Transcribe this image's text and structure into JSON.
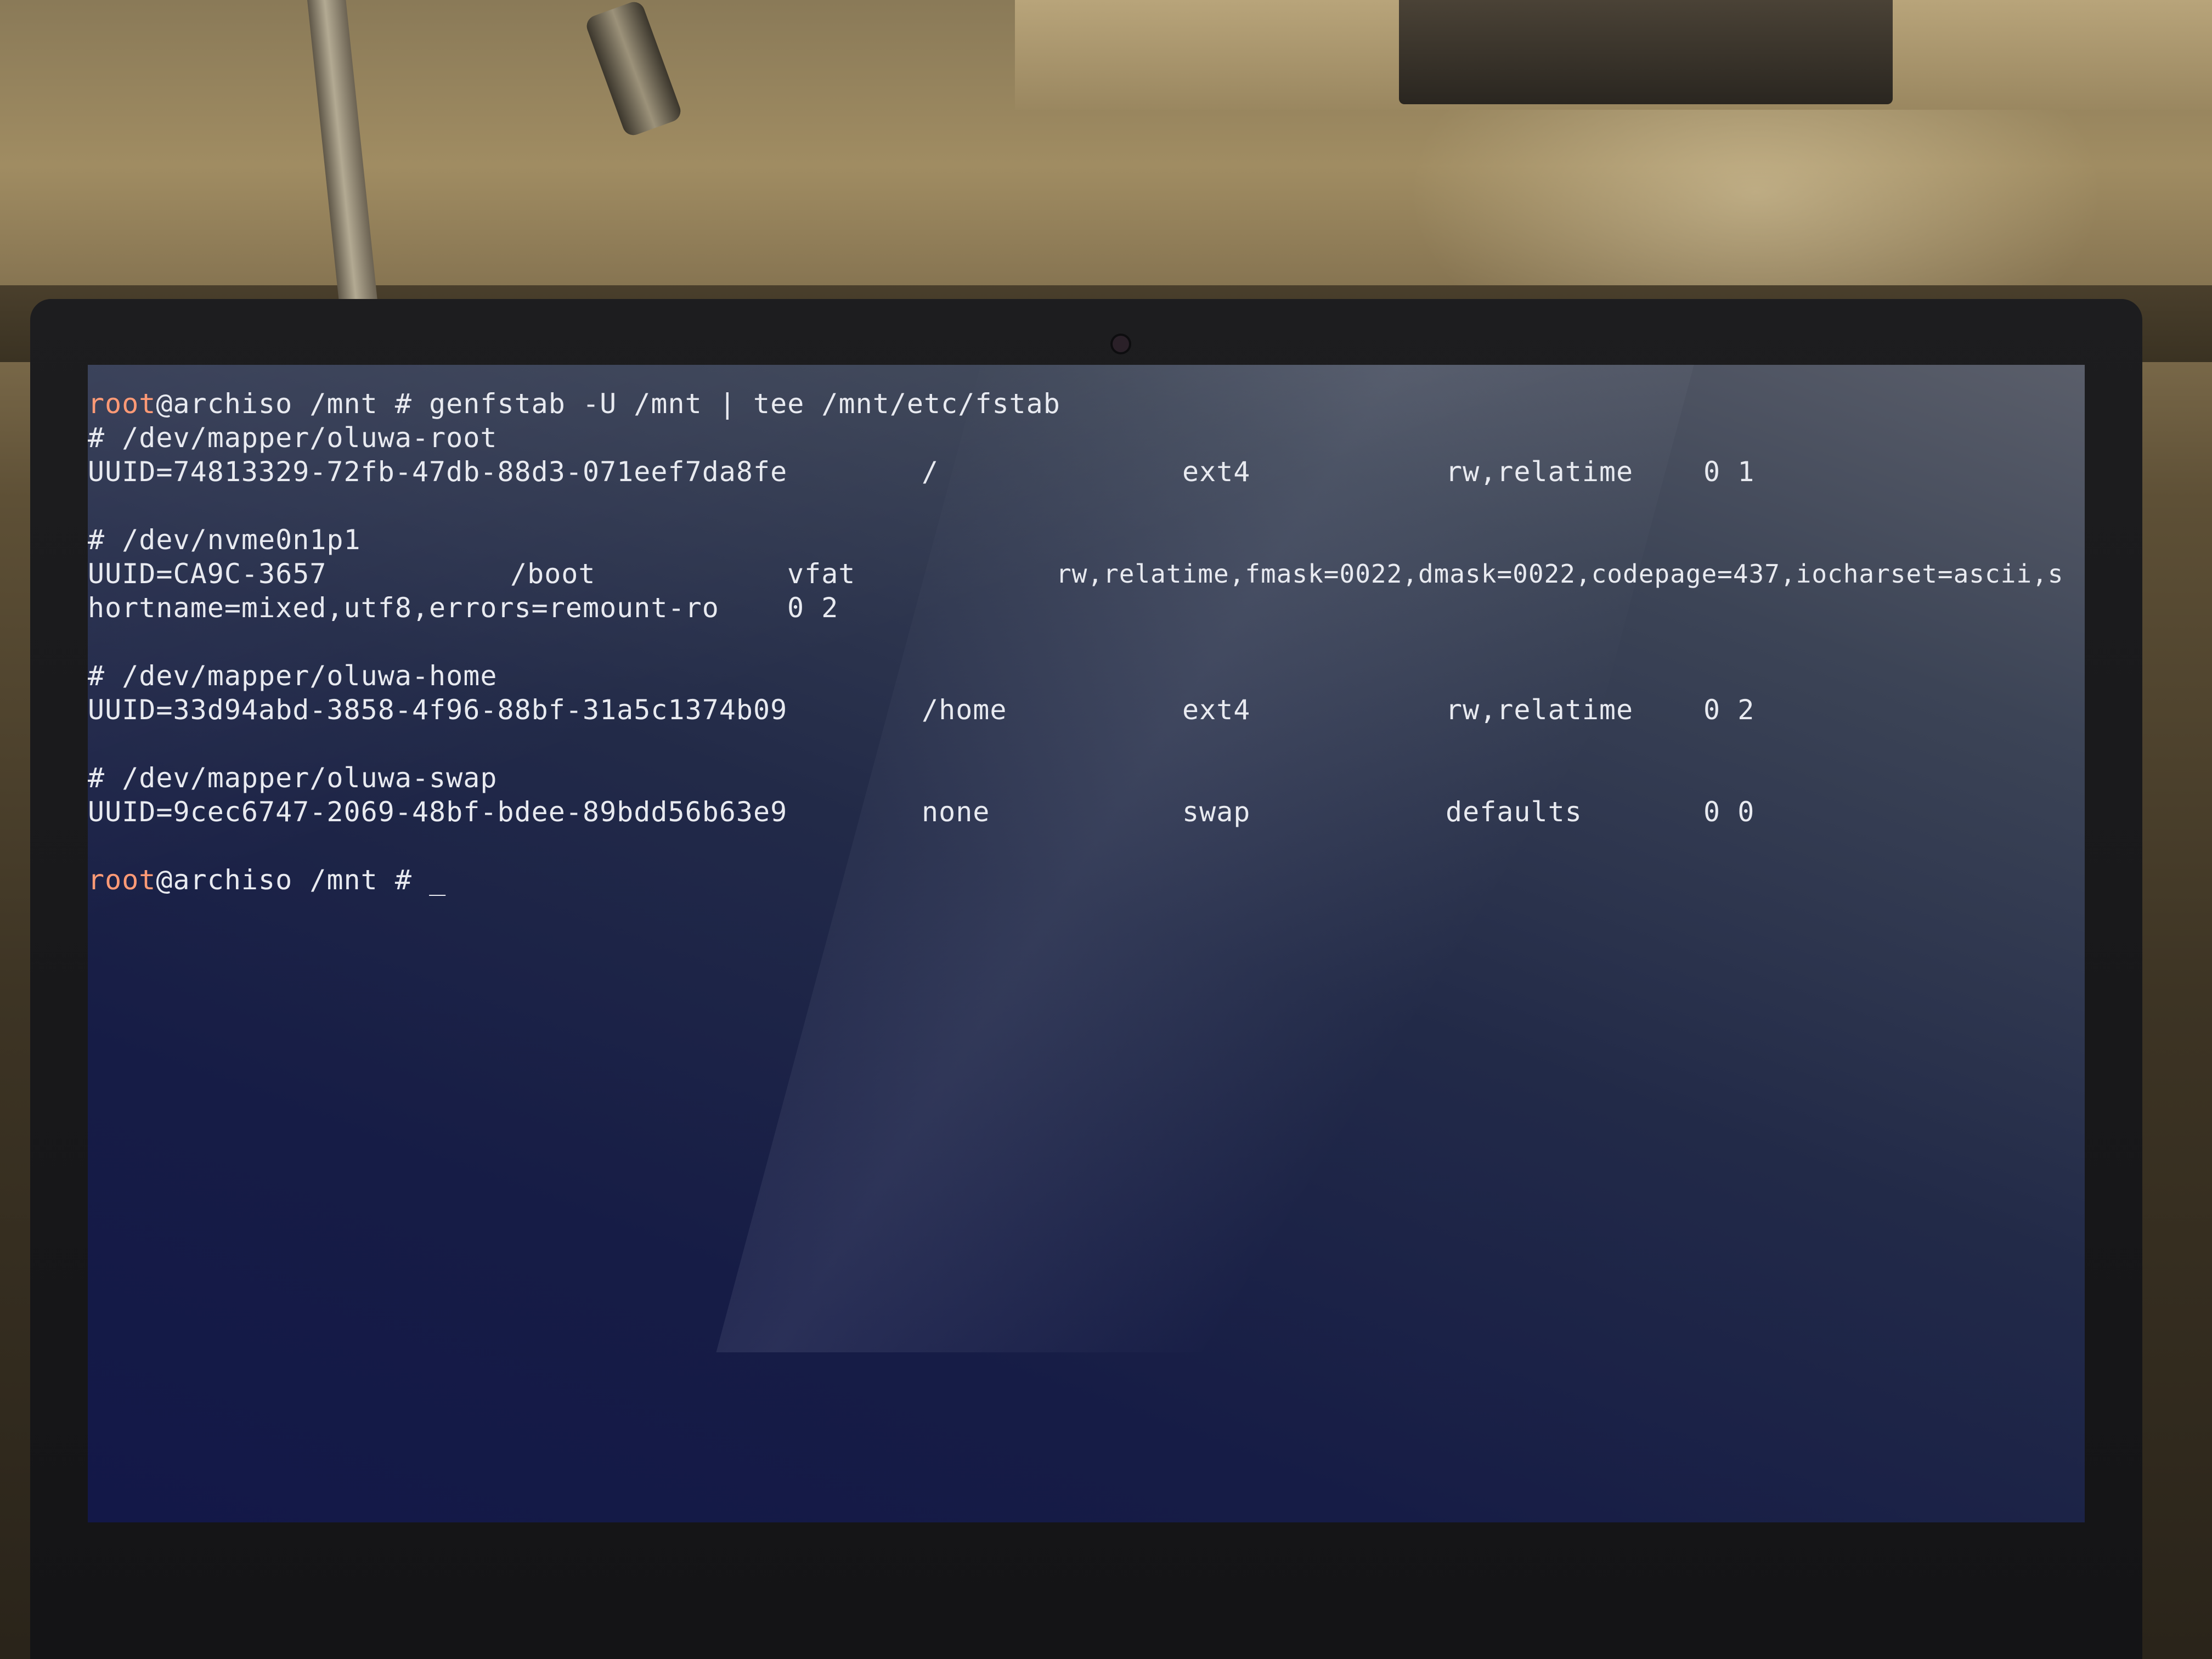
{
  "terminal": {
    "prompt_user": "root",
    "prompt_rest": "@archiso /mnt # ",
    "command": "genfstab -U /mnt | tee /mnt/etc/fstab",
    "entries": [
      {
        "comment": "# /dev/mapper/oluwa-root",
        "uuid": "UUID=74813329-72fb-47db-88d3-071eef7da8fe",
        "mountpoint": "/",
        "fstype": "ext4",
        "options": "rw,relatime",
        "dump_pass": "0 1"
      },
      {
        "comment": "# /dev/nvme0n1p1",
        "uuid": "UUID=CA9C-3657",
        "mountpoint": "/boot",
        "fstype": "vfat",
        "options": "rw,relatime,fmask=0022,dmask=0022,codepage=437,iocharset=ascii,s",
        "options_wrap": "hortname=mixed,utf8,errors=remount-ro",
        "dump_pass": "0 2"
      },
      {
        "comment": "# /dev/mapper/oluwa-home",
        "uuid": "UUID=33d94abd-3858-4f96-88bf-31a5c1374b09",
        "mountpoint": "/home",
        "fstype": "ext4",
        "options": "rw,relatime",
        "dump_pass": "0 2"
      },
      {
        "comment": "# /dev/mapper/oluwa-swap",
        "uuid": "UUID=9cec6747-2069-48bf-bdee-89bdd56b63e9",
        "mountpoint": "none",
        "fstype": "swap",
        "options": "defaults",
        "dump_pass": "0 0"
      }
    ],
    "cursor": "_"
  }
}
